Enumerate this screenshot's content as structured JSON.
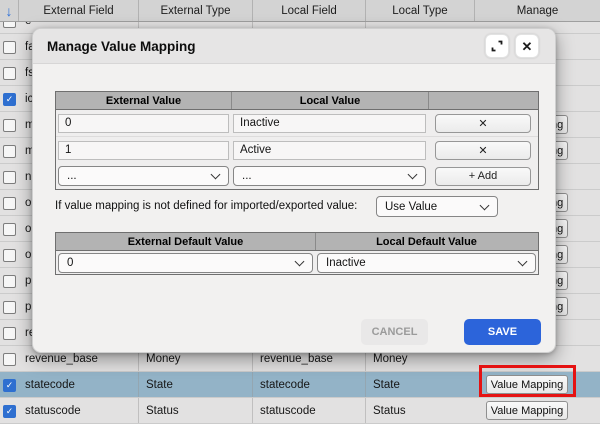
{
  "background_table": {
    "sort_icon": "arrow-down-icon",
    "columns": [
      "External Field",
      "External Type",
      "Local Field",
      "Local Type",
      "Manage"
    ],
    "value_mapping_label": "Value Mapping",
    "rows": [
      {
        "external_field": "e",
        "external_type": "",
        "local_field": "",
        "local_type": "",
        "checked": false,
        "highlighted": false,
        "has_value_mapping_button": false
      },
      {
        "external_field": "fa",
        "external_type": "",
        "local_field": "",
        "local_type": "",
        "checked": false,
        "highlighted": false,
        "has_value_mapping_button": false
      },
      {
        "external_field": "fs",
        "external_type": "",
        "local_field": "",
        "local_type": "",
        "checked": false,
        "highlighted": false,
        "has_value_mapping_button": false
      },
      {
        "external_field": "ic",
        "external_type": "",
        "local_field": "",
        "local_type": "",
        "checked": true,
        "highlighted": false,
        "has_value_mapping_button": false
      },
      {
        "external_field": "m",
        "external_type": "",
        "local_field": "",
        "local_type": "",
        "checked": false,
        "highlighted": false,
        "has_value_mapping_button": true
      },
      {
        "external_field": "m",
        "external_type": "",
        "local_field": "",
        "local_type": "",
        "checked": false,
        "highlighted": false,
        "has_value_mapping_button": true
      },
      {
        "external_field": "n",
        "external_type": "",
        "local_field": "",
        "local_type": "",
        "checked": false,
        "highlighted": false,
        "has_value_mapping_button": false
      },
      {
        "external_field": "o",
        "external_type": "",
        "local_field": "",
        "local_type": "",
        "checked": false,
        "highlighted": false,
        "has_value_mapping_button": true
      },
      {
        "external_field": "o",
        "external_type": "",
        "local_field": "",
        "local_type": "",
        "checked": false,
        "highlighted": false,
        "has_value_mapping_button": true
      },
      {
        "external_field": "o",
        "external_type": "",
        "local_field": "",
        "local_type": "",
        "checked": false,
        "highlighted": false,
        "has_value_mapping_button": true
      },
      {
        "external_field": "p",
        "external_type": "",
        "local_field": "",
        "local_type": "",
        "checked": false,
        "highlighted": false,
        "has_value_mapping_button": true
      },
      {
        "external_field": "p",
        "external_type": "",
        "local_field": "",
        "local_type": "",
        "checked": false,
        "highlighted": false,
        "has_value_mapping_button": true
      },
      {
        "external_field": "re",
        "external_type": "",
        "local_field": "",
        "local_type": "",
        "checked": false,
        "highlighted": false,
        "has_value_mapping_button": false
      },
      {
        "external_field": "revenue_base",
        "external_type": "Money",
        "local_field": "revenue_base",
        "local_type": "Money",
        "checked": false,
        "highlighted": false,
        "has_value_mapping_button": false
      },
      {
        "external_field": "statecode",
        "external_type": "State",
        "local_field": "statecode",
        "local_type": "State",
        "checked": true,
        "highlighted": true,
        "has_value_mapping_button": true,
        "annotated": true
      },
      {
        "external_field": "statuscode",
        "external_type": "Status",
        "local_field": "statuscode",
        "local_type": "Status",
        "checked": true,
        "highlighted": false,
        "has_value_mapping_button": true
      }
    ]
  },
  "dialog": {
    "title": "Manage Value Mapping",
    "window_icons": {
      "expand": "expand-icon",
      "close": "close-icon",
      "close_glyph": "✕"
    },
    "mapping_table": {
      "headers": [
        "External Value",
        "Local Value",
        ""
      ],
      "rows": [
        {
          "external_value": "0",
          "local_value": "Inactive",
          "remove_label": "✕"
        },
        {
          "external_value": "1",
          "local_value": "Active",
          "remove_label": "✕"
        }
      ],
      "new_row": {
        "external_select": "...",
        "local_select": "...",
        "add_button_label": "+ Add"
      }
    },
    "fallback": {
      "label": "If value mapping is not defined for imported/exported value:",
      "selected_value": "Use Value"
    },
    "default_table": {
      "headers": [
        "External Default Value",
        "Local Default Value"
      ],
      "external_default_value": "0",
      "local_default_value": "Inactive"
    },
    "actions": {
      "cancel_label": "CANCEL",
      "save_label": "SAVE"
    }
  },
  "annotation": {
    "shape": "red-rectangle",
    "target": "statecode-value-mapping-button"
  },
  "colors": {
    "save_button": "#2c64da",
    "row_highlight": "#93b3c7",
    "annotation_red": "#e51212",
    "checkbox_checked": "#2e6fd0"
  }
}
